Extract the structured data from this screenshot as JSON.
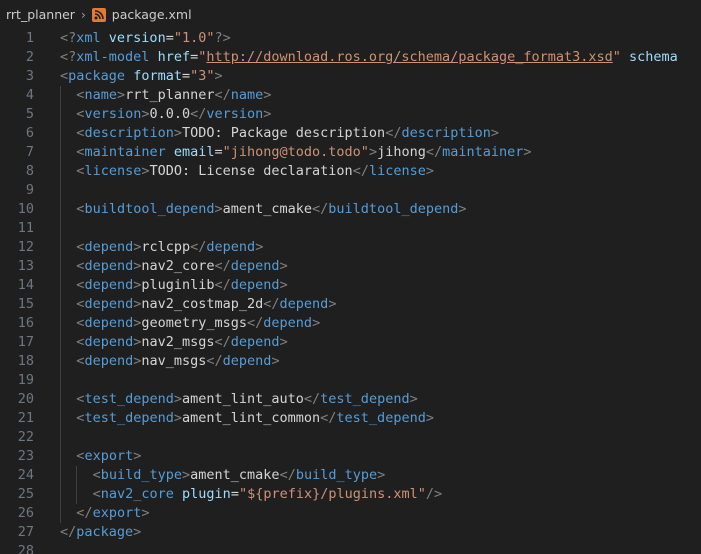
{
  "breadcrumb": {
    "folder": "rrt_planner",
    "file": "package.xml"
  },
  "colors": {
    "background": "#1f1f1f",
    "line_number": "#6e7681",
    "tag": "#569cd6",
    "attribute": "#9cdcfe",
    "string": "#ce9178",
    "text": "#d4d4d4",
    "punctuation": "#808080"
  },
  "lines": [
    {
      "n": "1",
      "indent": 0,
      "tokens": [
        [
          "pun",
          "<?"
        ],
        [
          "decl",
          "xml"
        ],
        [
          "txt",
          " "
        ],
        [
          "attr",
          "version"
        ],
        [
          "txt",
          "="
        ],
        [
          "str",
          "\"1.0\""
        ],
        [
          "pun",
          "?>"
        ]
      ]
    },
    {
      "n": "2",
      "indent": 0,
      "tokens": [
        [
          "pun",
          "<?"
        ],
        [
          "decl",
          "xml-model"
        ],
        [
          "txt",
          " "
        ],
        [
          "attr",
          "href"
        ],
        [
          "txt",
          "="
        ],
        [
          "str",
          "\""
        ],
        [
          "link",
          "http://download.ros.org/schema/package_format3.xsd"
        ],
        [
          "str",
          "\""
        ],
        [
          "txt",
          " "
        ],
        [
          "attr",
          "schema"
        ]
      ]
    },
    {
      "n": "3",
      "indent": 0,
      "tokens": [
        [
          "pun",
          "<"
        ],
        [
          "tag",
          "package"
        ],
        [
          "txt",
          " "
        ],
        [
          "attr",
          "format"
        ],
        [
          "txt",
          "="
        ],
        [
          "str",
          "\"3\""
        ],
        [
          "pun",
          ">"
        ]
      ]
    },
    {
      "n": "4",
      "indent": 1,
      "tokens": [
        [
          "pun",
          "<"
        ],
        [
          "tag",
          "name"
        ],
        [
          "pun",
          ">"
        ],
        [
          "txt",
          "rrt_planner"
        ],
        [
          "pun",
          "</"
        ],
        [
          "tag",
          "name"
        ],
        [
          "pun",
          ">"
        ]
      ]
    },
    {
      "n": "5",
      "indent": 1,
      "tokens": [
        [
          "pun",
          "<"
        ],
        [
          "tag",
          "version"
        ],
        [
          "pun",
          ">"
        ],
        [
          "txt",
          "0.0.0"
        ],
        [
          "pun",
          "</"
        ],
        [
          "tag",
          "version"
        ],
        [
          "pun",
          ">"
        ]
      ]
    },
    {
      "n": "6",
      "indent": 1,
      "tokens": [
        [
          "pun",
          "<"
        ],
        [
          "tag",
          "description"
        ],
        [
          "pun",
          ">"
        ],
        [
          "txt",
          "TODO: Package description"
        ],
        [
          "pun",
          "</"
        ],
        [
          "tag",
          "description"
        ],
        [
          "pun",
          ">"
        ]
      ]
    },
    {
      "n": "7",
      "indent": 1,
      "tokens": [
        [
          "pun",
          "<"
        ],
        [
          "tag",
          "maintainer"
        ],
        [
          "txt",
          " "
        ],
        [
          "attr",
          "email"
        ],
        [
          "txt",
          "="
        ],
        [
          "str",
          "\"jihong@todo.todo\""
        ],
        [
          "pun",
          ">"
        ],
        [
          "txt",
          "jihong"
        ],
        [
          "pun",
          "</"
        ],
        [
          "tag",
          "maintainer"
        ],
        [
          "pun",
          ">"
        ]
      ]
    },
    {
      "n": "8",
      "indent": 1,
      "tokens": [
        [
          "pun",
          "<"
        ],
        [
          "tag",
          "license"
        ],
        [
          "pun",
          ">"
        ],
        [
          "txt",
          "TODO: License declaration"
        ],
        [
          "pun",
          "</"
        ],
        [
          "tag",
          "license"
        ],
        [
          "pun",
          ">"
        ]
      ]
    },
    {
      "n": "9",
      "indent": 1,
      "tokens": []
    },
    {
      "n": "10",
      "indent": 1,
      "tokens": [
        [
          "pun",
          "<"
        ],
        [
          "tag",
          "buildtool_depend"
        ],
        [
          "pun",
          ">"
        ],
        [
          "txt",
          "ament_cmake"
        ],
        [
          "pun",
          "</"
        ],
        [
          "tag",
          "buildtool_depend"
        ],
        [
          "pun",
          ">"
        ]
      ]
    },
    {
      "n": "11",
      "indent": 1,
      "tokens": []
    },
    {
      "n": "12",
      "indent": 1,
      "tokens": [
        [
          "pun",
          "<"
        ],
        [
          "tag",
          "depend"
        ],
        [
          "pun",
          ">"
        ],
        [
          "txt",
          "rclcpp"
        ],
        [
          "pun",
          "</"
        ],
        [
          "tag",
          "depend"
        ],
        [
          "pun",
          ">"
        ]
      ]
    },
    {
      "n": "13",
      "indent": 1,
      "tokens": [
        [
          "pun",
          "<"
        ],
        [
          "tag",
          "depend"
        ],
        [
          "pun",
          ">"
        ],
        [
          "txt",
          "nav2_core"
        ],
        [
          "pun",
          "</"
        ],
        [
          "tag",
          "depend"
        ],
        [
          "pun",
          ">"
        ]
      ]
    },
    {
      "n": "14",
      "indent": 1,
      "tokens": [
        [
          "pun",
          "<"
        ],
        [
          "tag",
          "depend"
        ],
        [
          "pun",
          ">"
        ],
        [
          "txt",
          "pluginlib"
        ],
        [
          "pun",
          "</"
        ],
        [
          "tag",
          "depend"
        ],
        [
          "pun",
          ">"
        ]
      ]
    },
    {
      "n": "15",
      "indent": 1,
      "tokens": [
        [
          "pun",
          "<"
        ],
        [
          "tag",
          "depend"
        ],
        [
          "pun",
          ">"
        ],
        [
          "txt",
          "nav2_costmap_2d"
        ],
        [
          "pun",
          "</"
        ],
        [
          "tag",
          "depend"
        ],
        [
          "pun",
          ">"
        ]
      ]
    },
    {
      "n": "16",
      "indent": 1,
      "tokens": [
        [
          "pun",
          "<"
        ],
        [
          "tag",
          "depend"
        ],
        [
          "pun",
          ">"
        ],
        [
          "txt",
          "geometry_msgs"
        ],
        [
          "pun",
          "</"
        ],
        [
          "tag",
          "depend"
        ],
        [
          "pun",
          ">"
        ]
      ]
    },
    {
      "n": "17",
      "indent": 1,
      "tokens": [
        [
          "pun",
          "<"
        ],
        [
          "tag",
          "depend"
        ],
        [
          "pun",
          ">"
        ],
        [
          "txt",
          "nav2_msgs"
        ],
        [
          "pun",
          "</"
        ],
        [
          "tag",
          "depend"
        ],
        [
          "pun",
          ">"
        ]
      ]
    },
    {
      "n": "18",
      "indent": 1,
      "tokens": [
        [
          "pun",
          "<"
        ],
        [
          "tag",
          "depend"
        ],
        [
          "pun",
          ">"
        ],
        [
          "txt",
          "nav_msgs"
        ],
        [
          "pun",
          "</"
        ],
        [
          "tag",
          "depend"
        ],
        [
          "pun",
          ">"
        ]
      ]
    },
    {
      "n": "19",
      "indent": 1,
      "tokens": []
    },
    {
      "n": "20",
      "indent": 1,
      "tokens": [
        [
          "pun",
          "<"
        ],
        [
          "tag",
          "test_depend"
        ],
        [
          "pun",
          ">"
        ],
        [
          "txt",
          "ament_lint_auto"
        ],
        [
          "pun",
          "</"
        ],
        [
          "tag",
          "test_depend"
        ],
        [
          "pun",
          ">"
        ]
      ]
    },
    {
      "n": "21",
      "indent": 1,
      "tokens": [
        [
          "pun",
          "<"
        ],
        [
          "tag",
          "test_depend"
        ],
        [
          "pun",
          ">"
        ],
        [
          "txt",
          "ament_lint_common"
        ],
        [
          "pun",
          "</"
        ],
        [
          "tag",
          "test_depend"
        ],
        [
          "pun",
          ">"
        ]
      ]
    },
    {
      "n": "22",
      "indent": 1,
      "tokens": []
    },
    {
      "n": "23",
      "indent": 1,
      "tokens": [
        [
          "pun",
          "<"
        ],
        [
          "tag",
          "export"
        ],
        [
          "pun",
          ">"
        ]
      ]
    },
    {
      "n": "24",
      "indent": 2,
      "tokens": [
        [
          "pun",
          "<"
        ],
        [
          "tag",
          "build_type"
        ],
        [
          "pun",
          ">"
        ],
        [
          "txt",
          "ament_cmake"
        ],
        [
          "pun",
          "</"
        ],
        [
          "tag",
          "build_type"
        ],
        [
          "pun",
          ">"
        ]
      ]
    },
    {
      "n": "25",
      "indent": 2,
      "tokens": [
        [
          "pun",
          "<"
        ],
        [
          "tag",
          "nav2_core"
        ],
        [
          "txt",
          " "
        ],
        [
          "attr",
          "plugin"
        ],
        [
          "txt",
          "="
        ],
        [
          "str",
          "\"${prefix}/plugins.xml\""
        ],
        [
          "pun",
          "/>"
        ]
      ]
    },
    {
      "n": "26",
      "indent": 1,
      "tokens": [
        [
          "pun",
          "</"
        ],
        [
          "tag",
          "export"
        ],
        [
          "pun",
          ">"
        ]
      ]
    },
    {
      "n": "27",
      "indent": 0,
      "tokens": [
        [
          "pun",
          "</"
        ],
        [
          "tag",
          "package"
        ],
        [
          "pun",
          ">"
        ]
      ]
    },
    {
      "n": "28",
      "indent": 0,
      "tokens": []
    }
  ]
}
